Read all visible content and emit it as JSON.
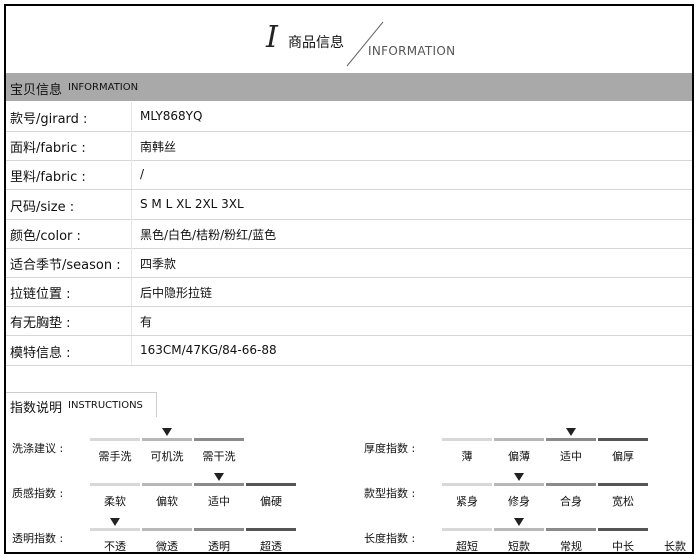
{
  "header": {
    "letter": "I",
    "title_zh": "商品信息",
    "title_en": "INFORMATION"
  },
  "info_section": {
    "title_zh": "宝贝信息",
    "title_en": "INFORMATION"
  },
  "info_rows": [
    {
      "label": "款号/girard :",
      "value": "MLY868YQ"
    },
    {
      "label": "面料/fabric :",
      "value": "南韩丝"
    },
    {
      "label": "里料/fabric :",
      "value": "/"
    },
    {
      "label": "尺码/size :",
      "value": "S M L XL 2XL 3XL"
    },
    {
      "label": "颜色/color :",
      "value": "黑色/白色/桔粉/粉红/蓝色"
    },
    {
      "label": "适合季节/season :",
      "value": "四季款"
    },
    {
      "label": "拉链位置 :",
      "value": "后中隐形拉链"
    },
    {
      "label": "有无胸垫 :",
      "value": "有"
    },
    {
      "label": "模特信息 :",
      "value": "163CM/47KG/84-66-88"
    }
  ],
  "instructions": {
    "title_zh": "指数说明",
    "title_en": "INSTRUCTIONS"
  },
  "scales": [
    {
      "label": "洗涤建议 :",
      "options": [
        "需手洗",
        "可机洗",
        "需干洗"
      ],
      "selected_index": 1
    },
    {
      "label": "质感指数 :",
      "options": [
        "柔软",
        "偏软",
        "适中",
        "偏硬"
      ],
      "selected_index": 2
    },
    {
      "label": "透明指数 :",
      "options": [
        "不透",
        "微透",
        "透明",
        "超透"
      ],
      "selected_index": 0
    },
    {
      "label": "厚度指数 :",
      "options": [
        "薄",
        "偏薄",
        "适中",
        "偏厚"
      ],
      "selected_index": 2
    },
    {
      "label": "款型指数 :",
      "options": [
        "紧身",
        "修身",
        "合身",
        "宽松"
      ],
      "selected_index": 1
    },
    {
      "label": "长度指数 :",
      "options": [
        "超短",
        "短款",
        "常规",
        "中长",
        "长款"
      ],
      "selected_index": 1
    }
  ],
  "colors": {
    "section_bar": "#a9a9a9",
    "segment_shades": [
      "#d8d8d8",
      "#b8b8b8",
      "#8a8a8a",
      "#555555",
      "#ffffff"
    ]
  }
}
